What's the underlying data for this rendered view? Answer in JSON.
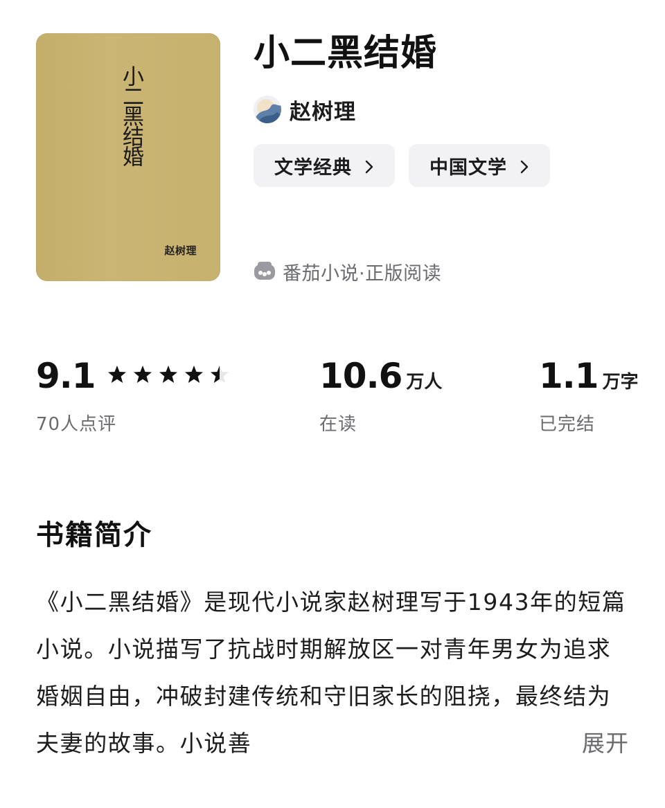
{
  "book": {
    "title": "小二黑结婚",
    "cover_title": "小二黑结婚",
    "cover_author": "赵树理",
    "author": "赵树理",
    "tags": [
      {
        "label": "文学经典"
      },
      {
        "label": "中国文学"
      }
    ],
    "source": "番茄小说·正版阅读",
    "cover_color": "#c8b26f"
  },
  "stats": {
    "rating": {
      "value": "9.1",
      "sub": "70人点评",
      "stars": 4.5
    },
    "readers": {
      "value": "10.6",
      "unit": "万人",
      "sub": "在读"
    },
    "words": {
      "value": "1.1",
      "unit": "万字",
      "sub": "已完结"
    }
  },
  "description": {
    "heading": "书籍简介",
    "text": "《小二黑结婚》是现代小说家赵树理写于1943年的短篇小说。小说描写了抗战时期解放区一对青年男女为追求婚姻自由，冲破封建传统和守旧家长的阻挠，最终结为夫妻的故事。小说善",
    "expand_label": "展开"
  },
  "icons": {
    "chevron": "chevron-right-icon",
    "source": "tomato-novel-icon",
    "star": "star-icon",
    "avatar": "author-avatar"
  }
}
